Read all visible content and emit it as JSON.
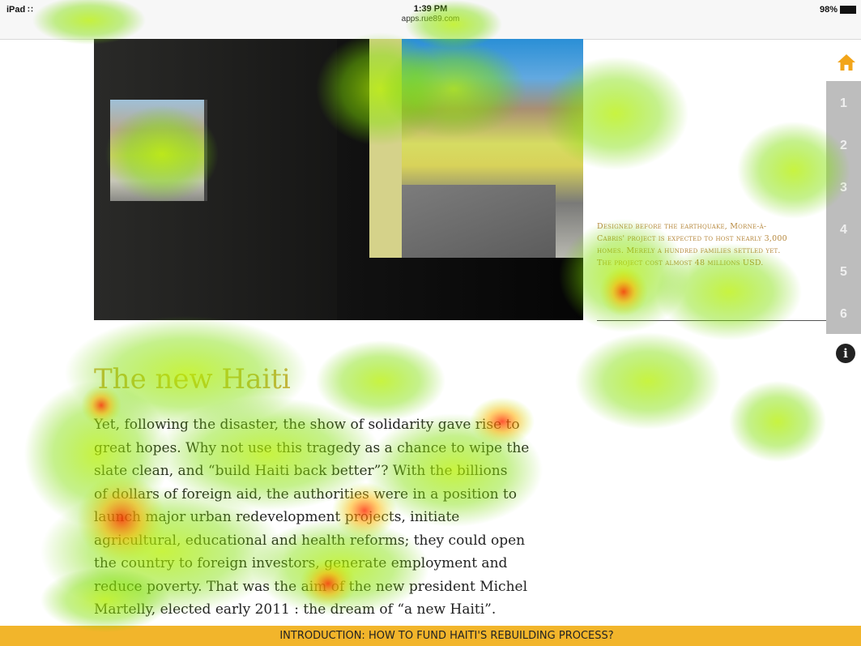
{
  "status_bar": {
    "device": "iPad",
    "time": "1:39 PM",
    "url": "apps.rue89.com",
    "battery": "98%"
  },
  "caption": "Designed before the earthquake, Morne-à-Cabris' project is expected to host nearly 3,000 homes. Merely a hundred families settled yet. The project cost almost 48 millions USD.",
  "nav": {
    "home_icon": "home-icon",
    "items": [
      "1",
      "2",
      "3",
      "4",
      "5",
      "6"
    ],
    "info_icon": "info-icon",
    "info_glyph": "i"
  },
  "article": {
    "title": "The new Haiti",
    "lines": [
      "Yet, following the disaster, the show of solidarity gave rise to",
      "great hopes. Why not use this tragedy as a chance to wipe the",
      "slate clean, and “build Haiti back better”? With the billions",
      "of dollars of foreign aid, the authorities were in a position to",
      "launch major urban redevelopment projects, initiate",
      "agricultural, educational and health reforms; they could open",
      "the country to foreign investors, generate employment and",
      "reduce poverty. That was the aim of the new president Michel",
      "Martelly, elected early 2011 : the dream of “a new Haiti”."
    ]
  },
  "footer": {
    "label": "INTRODUCTION: HOW TO FUND HAITI'S REBUILDING PROCESS?"
  },
  "colors": {
    "accent": "#f2b52b",
    "title": "#d2b04a",
    "nav_bg": "#bdbdbd",
    "home": "#f2a51a"
  }
}
